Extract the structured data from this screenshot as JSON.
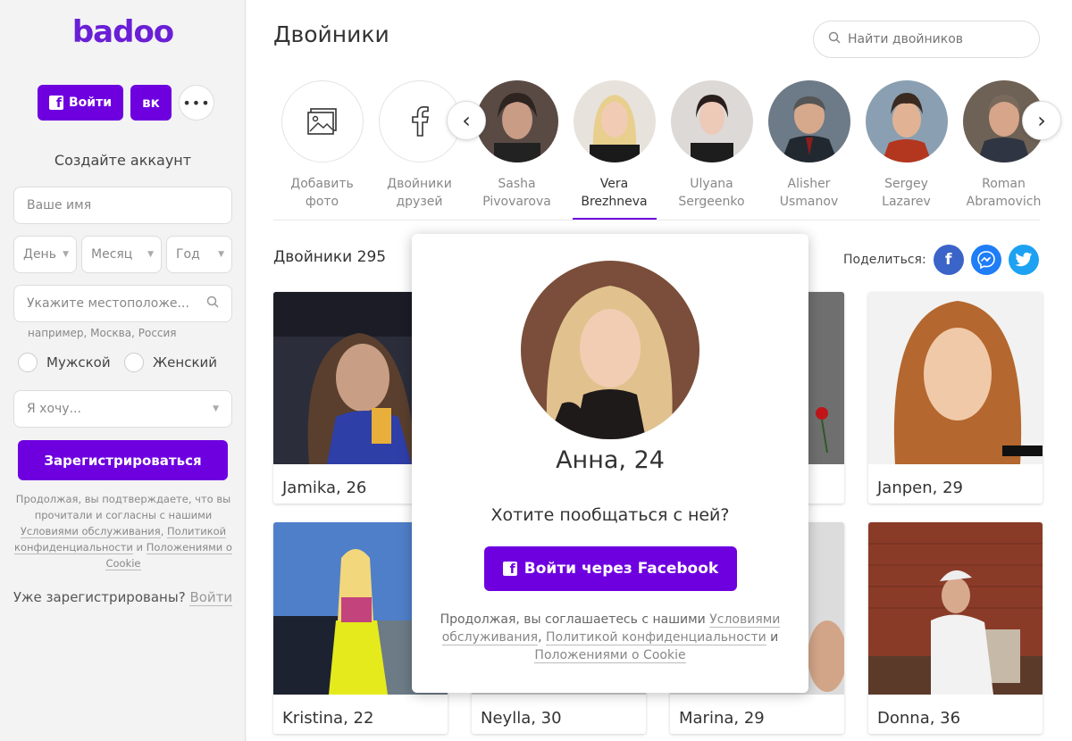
{
  "brand": {
    "logo": "badoo",
    "accent": "#6e00e0"
  },
  "sidebar": {
    "login_label": "Войти",
    "vk_label": "вк",
    "more_label": "•••",
    "create_title": "Создайте аккаунт",
    "name_placeholder": "Ваше имя",
    "day_label": "День",
    "month_label": "Месяц",
    "year_label": "Год",
    "location_placeholder": "Укажите местоположе...",
    "location_hint": "например, Москва, Россия",
    "gender_male": "Мужской",
    "gender_female": "Женский",
    "intent_label": "Я хочу...",
    "register_label": "Зарегистрироваться",
    "terms_prefix": "Продолжая, вы подтверждаете, что вы прочитали и согласны с нашими",
    "terms_link1": "Условиями обслуживания",
    "terms_sep1": ", ",
    "terms_link2": "Политикой конфиденциальности",
    "terms_sep2": " и ",
    "terms_link3": "Положениями о Cookie",
    "already_text": "Уже зарегистрированы?",
    "already_link": "Войти"
  },
  "main": {
    "title": "Двойники",
    "search_placeholder": "Найти двойников",
    "celebs": [
      {
        "line1": "Добавить",
        "line2": "фото",
        "icon": "photo-icon"
      },
      {
        "line1": "Двойники",
        "line2": "друзей",
        "icon": "facebook-icon"
      },
      {
        "line1": "Sasha",
        "line2": "Pivovarova"
      },
      {
        "line1": "Vera",
        "line2": "Brezhneva",
        "active": true
      },
      {
        "line1": "Ulyana",
        "line2": "Sergeenko"
      },
      {
        "line1": "Alisher",
        "line2": "Usmanov"
      },
      {
        "line1": "Sergey",
        "line2": "Lazarev"
      },
      {
        "line1": "Roman",
        "line2": "Abramovich"
      }
    ],
    "count_title": "Двойники 295",
    "share_label": "Поделиться:",
    "cards": [
      {
        "caption": "Jamika, 26"
      },
      {
        "caption": ""
      },
      {
        "caption": ""
      },
      {
        "caption": "Janpen, 29"
      },
      {
        "caption": "Kristina, 22"
      },
      {
        "caption": "Neylla, 30"
      },
      {
        "caption": "Marina, 29"
      },
      {
        "caption": "Donna, 36"
      }
    ]
  },
  "modal": {
    "close_label": "×",
    "name": "Анна, 24",
    "question": "Хотите пообщаться с ней?",
    "button_label": "Войти через Facebook",
    "terms_prefix": "Продолжая, вы соглашаетесь с нашими ",
    "terms_link1": "Условиями обслуживания",
    "terms_sep1": ", ",
    "terms_link2": "Политикой конфиденциальности",
    "terms_sep2": " и ",
    "terms_link3": "Положениями о Cookie"
  },
  "colors": {
    "facebook": "#3b64c9",
    "messenger": "#1e7df7",
    "twitter": "#1da1f2"
  }
}
